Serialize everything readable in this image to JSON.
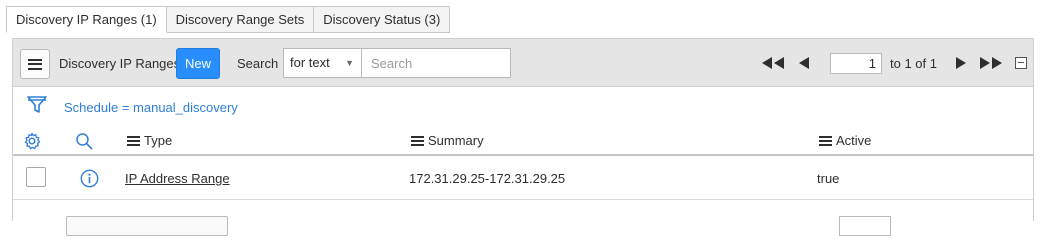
{
  "tabs": [
    {
      "label": "Discovery IP Ranges (1)",
      "active": true
    },
    {
      "label": "Discovery Range Sets",
      "active": false
    },
    {
      "label": "Discovery Status (3)",
      "active": false
    }
  ],
  "toolbar": {
    "menu_icon": "hamburger-icon",
    "list_title": "Discovery IP Ranges",
    "new_label": "New",
    "search_label": "Search",
    "search_field_selected": "for text",
    "search_placeholder": "Search"
  },
  "pagination": {
    "current_page": "1",
    "range_text": "to 1 of 1",
    "icons": [
      "first-page-icon",
      "previous-page-icon",
      "next-page-icon",
      "last-page-icon",
      "collapse-icon"
    ]
  },
  "filter": {
    "icon": "funnel-icon",
    "breadcrumb": "Schedule = manual_discovery"
  },
  "table": {
    "columns": [
      "Type",
      "Summary",
      "Active"
    ],
    "header_icons": [
      "gear-icon",
      "search-icon"
    ],
    "rows": [
      {
        "type": "IP Address Range",
        "summary": "172.31.29.25-172.31.29.25",
        "active": "true"
      }
    ]
  },
  "colors": {
    "accent": "#278efc",
    "link": "#2f7ed8",
    "toolbar_bg": "#e5e5e5"
  }
}
